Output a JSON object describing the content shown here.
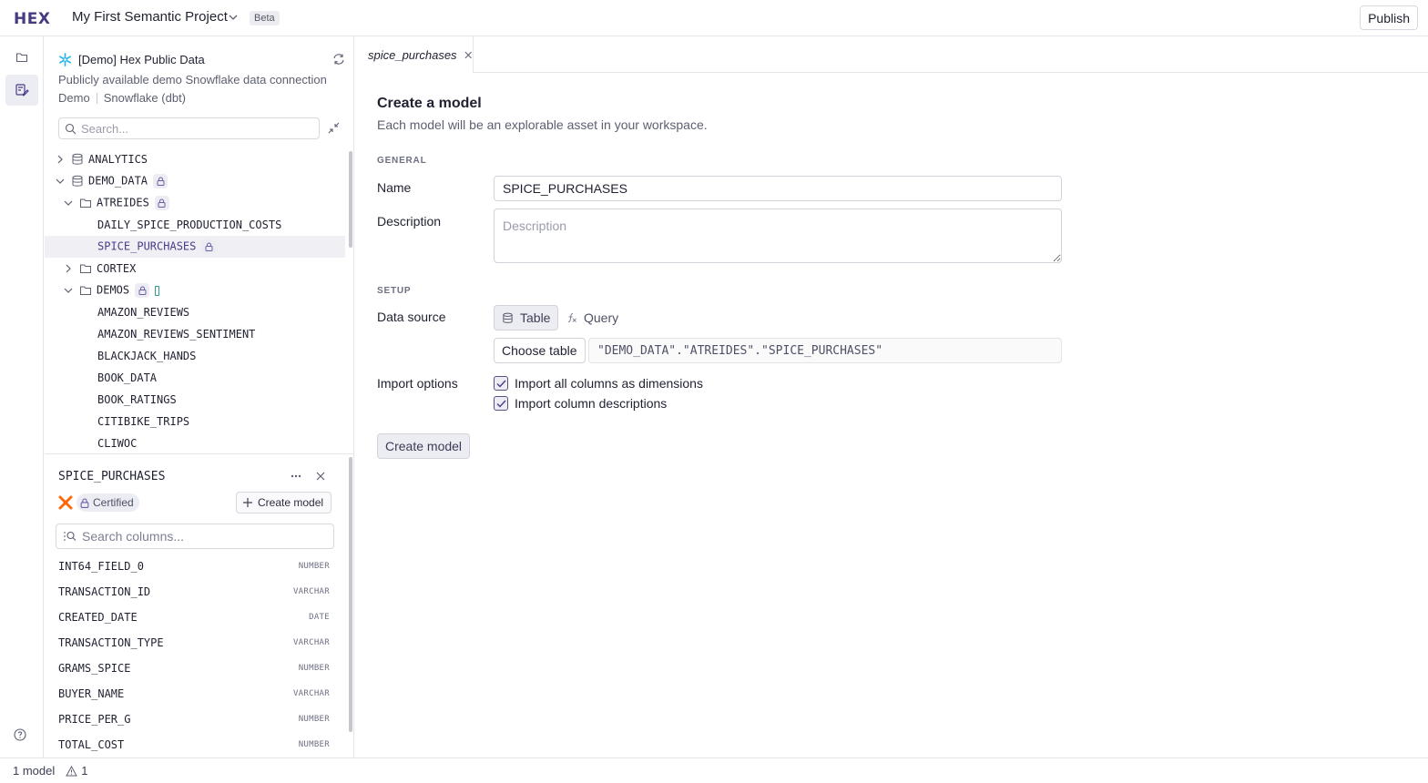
{
  "app": {
    "logo": "HEX",
    "project_title": "My First Semantic Project",
    "beta_badge": "Beta",
    "publish_label": "Publish"
  },
  "connection": {
    "name": "[Demo] Hex Public Data",
    "description": "Publicly available demo Snowflake data connection",
    "tag": "Demo",
    "type": "Snowflake (dbt)",
    "search_placeholder": "Search..."
  },
  "tree": [
    {
      "label": "ANALYTICS"
    },
    {
      "label": "DEMO_DATA"
    },
    {
      "label": "ATREIDES"
    },
    {
      "label": "DAILY_SPICE_PRODUCTION_COSTS"
    },
    {
      "label": "SPICE_PURCHASES"
    },
    {
      "label": "CORTEX"
    },
    {
      "label": "DEMOS"
    },
    {
      "label": "AMAZON_REVIEWS"
    },
    {
      "label": "AMAZON_REVIEWS_SENTIMENT"
    },
    {
      "label": "BLACKJACK_HANDS"
    },
    {
      "label": "BOOK_DATA"
    },
    {
      "label": "BOOK_RATINGS"
    },
    {
      "label": "CITIBIKE_TRIPS"
    },
    {
      "label": "CLIWOC"
    }
  ],
  "detail": {
    "title": "SPICE_PURCHASES",
    "certified_label": "Certified",
    "create_model_label": "Create model",
    "search_placeholder": "Search columns...",
    "columns": [
      {
        "name": "INT64_FIELD_0",
        "type": "NUMBER"
      },
      {
        "name": "TRANSACTION_ID",
        "type": "VARCHAR"
      },
      {
        "name": "CREATED_DATE",
        "type": "DATE"
      },
      {
        "name": "TRANSACTION_TYPE",
        "type": "VARCHAR"
      },
      {
        "name": "GRAMS_SPICE",
        "type": "NUMBER"
      },
      {
        "name": "BUYER_NAME",
        "type": "VARCHAR"
      },
      {
        "name": "PRICE_PER_G",
        "type": "NUMBER"
      },
      {
        "name": "TOTAL_COST",
        "type": "NUMBER"
      }
    ]
  },
  "tab": {
    "label": "spice_purchases"
  },
  "form": {
    "title": "Create a model",
    "subtitle": "Each model will be an explorable asset in your workspace.",
    "general_label": "GENERAL",
    "name_label": "Name",
    "name_value": "SPICE_PURCHASES",
    "description_label": "Description",
    "description_placeholder": "Description",
    "setup_label": "SETUP",
    "data_source_label": "Data source",
    "table_option": "Table",
    "query_option": "Query",
    "choose_table_label": "Choose table",
    "table_reference": "\"DEMO_DATA\".\"ATREIDES\".\"SPICE_PURCHASES\"",
    "import_options_label": "Import options",
    "import_dimensions_label": "Import all columns as dimensions",
    "import_descriptions_label": "Import column descriptions",
    "create_button_label": "Create model"
  },
  "status": {
    "models": "1 model",
    "warnings": "1"
  },
  "colors": {
    "accent": "#473982",
    "selected_bg": "#f0f0f4",
    "lock_badge": "#ececf3"
  }
}
